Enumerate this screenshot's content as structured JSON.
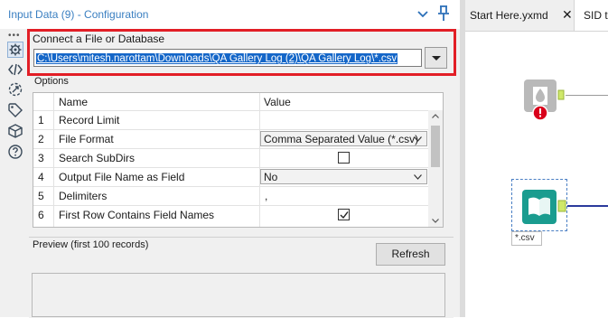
{
  "config_panel": {
    "title": "Input Data (9) - Configuration",
    "connect_label": "Connect a File or Database",
    "file_path": "C:\\Users\\mitesh.narottam\\Downloads\\QA Gallery Log (2)\\QA Gallery Log\\*.csv",
    "options_label": "Options",
    "table": {
      "columns": [
        "Name",
        "Value"
      ],
      "rows": [
        {
          "num": "1",
          "name": "Record Limit",
          "value": ""
        },
        {
          "num": "2",
          "name": "File Format",
          "value": "Comma Separated Value (*.csv)"
        },
        {
          "num": "3",
          "name": "Search SubDirs",
          "value": "unchecked"
        },
        {
          "num": "4",
          "name": "Output File Name as Field",
          "value": "No"
        },
        {
          "num": "5",
          "name": "Delimiters",
          "value": ","
        },
        {
          "num": "6",
          "name": "First Row Contains Field Names",
          "value": "checked"
        }
      ]
    },
    "preview_label": "Preview (first 100 records)",
    "refresh_label": "Refresh",
    "rail_icons": [
      "gear-icon",
      "code-icon",
      "annotation-icon",
      "tag-icon",
      "cube-icon",
      "help-icon"
    ]
  },
  "canvas": {
    "tabs": [
      {
        "label": "Start Here.yxmd"
      },
      {
        "label": "SID to"
      }
    ],
    "close_symbol": "✕",
    "input_tool_caption": "*.csv"
  },
  "colors": {
    "title_text": "#3a7fc1",
    "highlight_border": "#e21e26",
    "selection_bg": "#1466c8",
    "input_tool": "#1a9c8f",
    "error_badge": "#d9001b",
    "connector_line": "#2b3a9c"
  }
}
